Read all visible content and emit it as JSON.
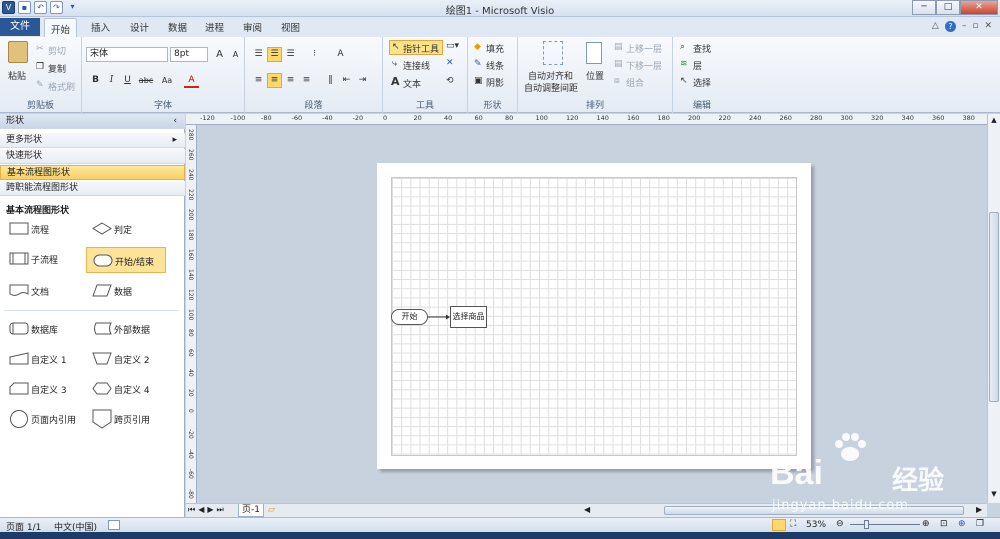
{
  "app": {
    "title": "绘图1 - Microsoft Visio",
    "colors": {
      "file_tab": "#2b5797",
      "highlight": "#fcd96a",
      "canvas_bg": "#c8d2de"
    }
  },
  "quick_access": {
    "icons": [
      "visio-logo-icon",
      "save-icon",
      "undo-icon",
      "redo-icon",
      "customize-icon"
    ]
  },
  "window_controls": {
    "minimize": "─",
    "maximize": "□",
    "close": "✕"
  },
  "tabs": {
    "file": "文件",
    "items": [
      "开始",
      "插入",
      "设计",
      "数据",
      "进程",
      "审阅",
      "视图"
    ],
    "active": "开始"
  },
  "ribbon": {
    "clipboard": {
      "label": "剪贴板",
      "paste": "粘贴",
      "cut": "剪切",
      "copy": "复制",
      "format_painter": "格式刷"
    },
    "font": {
      "label": "字体",
      "family": "宋体",
      "size": "8pt",
      "bold": "B",
      "italic": "I",
      "underline": "U",
      "strike": "abc",
      "case": "Aa",
      "color": "A",
      "grow": "A",
      "shrink": "A"
    },
    "paragraph": {
      "label": "段落"
    },
    "tools": {
      "label": "工具",
      "pointer": "指针工具",
      "connector": "连接线",
      "text": "文本"
    },
    "shape": {
      "label": "形状",
      "fill": "填充",
      "line": "线条",
      "shadow": "阴影"
    },
    "arrange": {
      "label": "排列",
      "auto_align_1": "自动对齐和",
      "auto_align_2": "自动调整间距",
      "position": "位置",
      "bring_forward": "上移一层",
      "send_backward": "下移一层",
      "group": "组合"
    },
    "editing": {
      "label": "编辑",
      "find": "查找",
      "layers": "层",
      "select": "选择"
    }
  },
  "shapes_panel": {
    "header": "形状",
    "nav": [
      "更多形状",
      "快速形状",
      "基本流程图形状",
      "跨职能流程图形状"
    ],
    "selected_nav": "基本流程图形状",
    "stencil_title": "基本流程图形状",
    "items": [
      {
        "label": "流程",
        "icon": "process-shape-icon"
      },
      {
        "label": "判定",
        "icon": "decision-shape-icon"
      },
      {
        "label": "子流程",
        "icon": "subprocess-shape-icon"
      },
      {
        "label": "开始/结束",
        "icon": "terminator-shape-icon"
      },
      {
        "label": "文档",
        "icon": "document-shape-icon"
      },
      {
        "label": "数据",
        "icon": "data-shape-icon"
      },
      {
        "label": "数据库",
        "icon": "database-shape-icon"
      },
      {
        "label": "外部数据",
        "icon": "external-data-shape-icon"
      },
      {
        "label": "自定义 1",
        "icon": "custom1-shape-icon"
      },
      {
        "label": "自定义 2",
        "icon": "custom2-shape-icon"
      },
      {
        "label": "自定义 3",
        "icon": "custom3-shape-icon"
      },
      {
        "label": "自定义 4",
        "icon": "custom4-shape-icon"
      },
      {
        "label": "页面内引用",
        "icon": "on-page-reference-icon"
      },
      {
        "label": "跨页引用",
        "icon": "off-page-reference-icon"
      }
    ],
    "selected_item": "开始/结束"
  },
  "ruler": {
    "h_ticks": [
      "-120",
      "-100",
      "-80",
      "-60",
      "-40",
      "-20",
      "0",
      "20",
      "40",
      "60",
      "80",
      "100",
      "120",
      "140",
      "160",
      "180",
      "200",
      "220",
      "240",
      "260",
      "280",
      "300",
      "320",
      "340",
      "360",
      "380",
      "400"
    ],
    "v_ticks": [
      "280",
      "260",
      "240",
      "220",
      "200",
      "180",
      "160",
      "140",
      "120",
      "100",
      "80",
      "60",
      "40",
      "20",
      "0",
      "-20",
      "-40",
      "-60",
      "-80"
    ]
  },
  "diagram": {
    "start_label": "开始",
    "process_label": "选择商品"
  },
  "page_tabs": {
    "current": "页-1"
  },
  "status": {
    "page": "页面 1/1",
    "language": "中文(中国)",
    "zoom": "53%"
  },
  "watermark": {
    "brand": "Bai",
    "suffix": "经验",
    "url": "jingyan.baidu.com"
  }
}
